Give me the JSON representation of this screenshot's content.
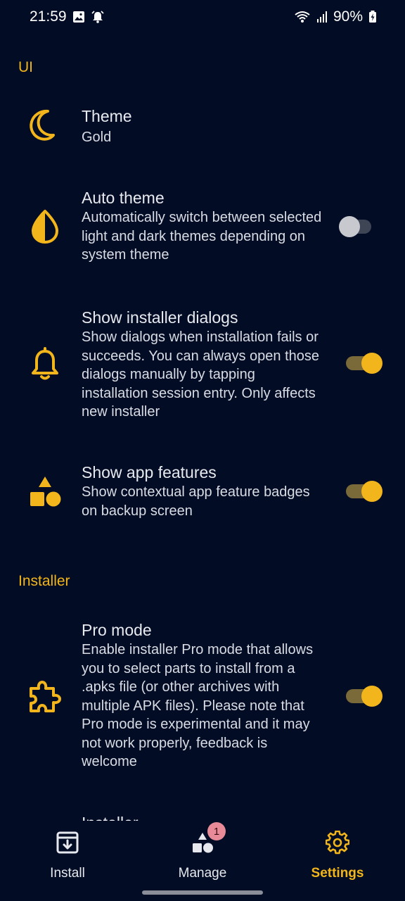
{
  "status_bar": {
    "time": "21:59",
    "battery": "90%",
    "icons": [
      "gallery-icon",
      "alarm-icon",
      "wifi-icon",
      "signal-icon",
      "battery-charging-icon"
    ]
  },
  "sections": {
    "ui_header": "UI",
    "installer_header": "Installer"
  },
  "settings": {
    "theme": {
      "title": "Theme",
      "desc": "Gold",
      "icon": "moon-icon"
    },
    "auto_theme": {
      "title": "Auto theme",
      "desc": "Automatically switch between selected light and dark themes depending on system theme",
      "icon": "contrast-icon",
      "enabled": false
    },
    "installer_dialogs": {
      "title": "Show installer dialogs",
      "desc": "Show dialogs when installation fails or succeeds. You can always open those dialogs manually by tapping installation session entry. Only affects new installer",
      "icon": "bell-icon",
      "enabled": true
    },
    "app_features": {
      "title": "Show app features",
      "desc": "Show contextual app feature badges on backup screen",
      "icon": "shapes-icon",
      "enabled": true
    },
    "pro_mode": {
      "title": "Pro mode",
      "desc": "Enable installer Pro mode that allows you to select parts to install from a .apks file (or other archives with multiple APK files). Please note that Pro mode is experimental and it may not work properly, feedback is welcome",
      "icon": "puzzle-icon",
      "enabled": true
    },
    "next_item_title": "Installer"
  },
  "bottom_nav": {
    "install": "Install",
    "manage": "Manage",
    "manage_badge": "1",
    "settings": "Settings",
    "active": "settings"
  },
  "colors": {
    "background": "#020c24",
    "accent": "#f2b51b"
  }
}
